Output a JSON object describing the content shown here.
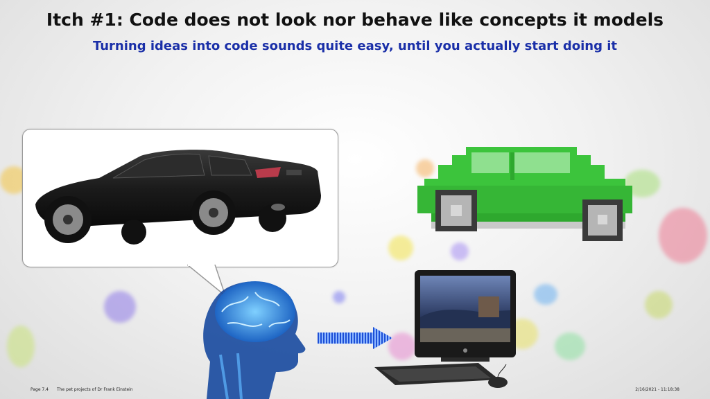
{
  "slide": {
    "title": "Itch #1: Code does not look nor behave like concepts it models",
    "subtitle": "Turning ideas into code sounds quite easy, until you actually start doing it"
  },
  "illustrations": {
    "bubble_image": "realistic-black-coupe",
    "pixel_car": "pixelated-green-beetle",
    "head": "glowing-brain-head",
    "arrow": "striped-blue-arrow",
    "computer": "all-in-one-pc-with-keyboard-mouse"
  },
  "footer": {
    "page": "Page 7.4",
    "project": "The pet projects of Dr Frank Einstein",
    "timestamp": "2/16/2021 - 11:18:38"
  },
  "colors": {
    "title": "#111111",
    "subtitle": "#1a2fa8",
    "pixel_car": "#3cc43c",
    "brain": "#2a8cff"
  }
}
